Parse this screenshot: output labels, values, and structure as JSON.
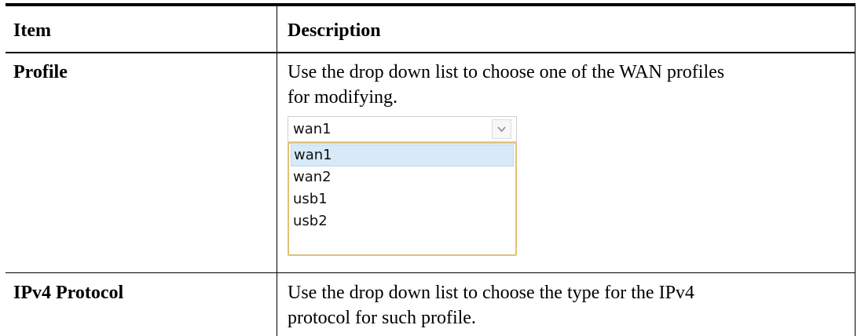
{
  "table": {
    "header": {
      "item": "Item",
      "description": "Description"
    },
    "rows": [
      {
        "item": "Profile",
        "description_lines": [
          "Use the drop down list to choose one of the WAN profiles",
          "for modifying."
        ]
      },
      {
        "item": "IPv4 Protocol",
        "description_lines": [
          "Use the drop down list to choose the type for the IPv4",
          "protocol for such profile."
        ]
      }
    ]
  },
  "profile_select": {
    "selected": "wan1",
    "options": [
      "wan1",
      "wan2",
      "usb1",
      "usb2"
    ],
    "highlighted_option": "wan1"
  },
  "colors": {
    "dropdown_border": "#e0c277",
    "option_highlight": "#d6eaf9"
  }
}
